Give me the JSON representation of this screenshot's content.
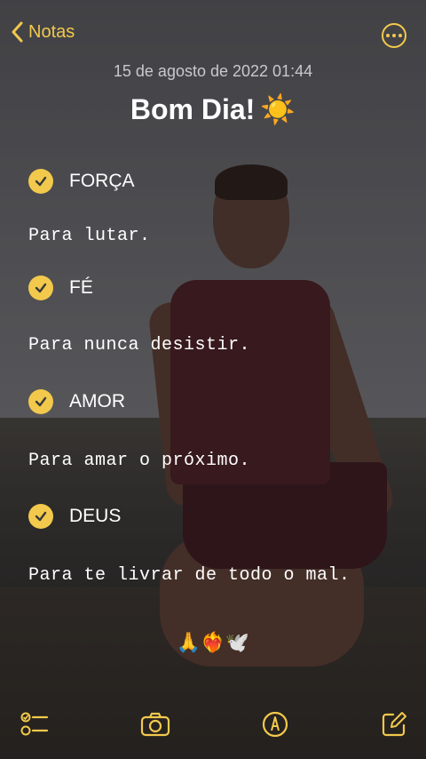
{
  "nav": {
    "back_label": "Notas"
  },
  "note": {
    "date": "15 de agosto de 2022 01:44",
    "title": "Bom Dia!",
    "title_emoji": "☀️",
    "items": [
      {
        "label": "FORÇA",
        "checked": true,
        "text": "Para lutar."
      },
      {
        "label": "FÉ",
        "checked": true,
        "text": "Para nunca desistir."
      },
      {
        "label": "AMOR",
        "checked": true,
        "text": "Para amar o próximo."
      },
      {
        "label": "DEUS",
        "checked": true,
        "text": "Para te livrar de todo o mal."
      }
    ],
    "emojis": "🙏❤️‍🔥🕊️"
  },
  "toolbar": {
    "icons": [
      "checklist-icon",
      "camera-icon",
      "markup-icon",
      "compose-icon"
    ]
  },
  "colors": {
    "accent": "#f2c94c"
  }
}
